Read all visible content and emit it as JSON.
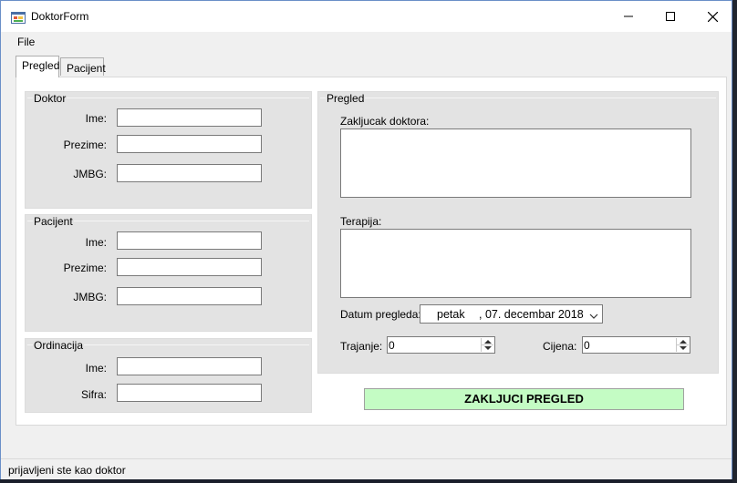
{
  "window": {
    "title": "DoktorForm"
  },
  "menu": {
    "file": "File"
  },
  "tabs": [
    {
      "label": "Pregled",
      "active": true
    },
    {
      "label": "Pacijent",
      "active": false
    }
  ],
  "doktor": {
    "title": "Doktor",
    "ime_label": "Ime:",
    "prezime_label": "Prezime:",
    "jmbg_label": "JMBG:",
    "ime_value": "",
    "prezime_value": "",
    "jmbg_value": ""
  },
  "pacijent": {
    "title": "Pacijent",
    "ime_label": "Ime:",
    "prezime_label": "Prezime:",
    "jmbg_label": "JMBG:",
    "ime_value": "",
    "prezime_value": "",
    "jmbg_value": ""
  },
  "ordinacija": {
    "title": "Ordinacija",
    "ime_label": "Ime:",
    "sifra_label": "Sifra:",
    "ime_value": "",
    "sifra_value": ""
  },
  "pregled": {
    "title": "Pregled",
    "zakljucak_label": "Zakljucak doktora:",
    "terapija_label": "Terapija:",
    "datum_label": "Datum pregleda:",
    "datum_day": "petak",
    "datum_rest": ", 07. decembar 2018",
    "trajanje_label": "Trajanje:",
    "trajanje_value": "0",
    "cijena_label": "Cijena:",
    "cijena_value": "0"
  },
  "actions": {
    "zakljuci": "ZAKLJUCI PREGLED"
  },
  "status": {
    "text": "prijavljeni ste kao doktor"
  },
  "colors": {
    "button_bg": "#c4fcc4",
    "group_bg": "#e3e3e3",
    "window_bg": "#f0f0f0"
  },
  "icons": {
    "app": "app-form-icon",
    "minimize": "minimize-icon",
    "maximize": "maximize-icon",
    "close": "close-icon",
    "dropdown": "chevron-down-icon"
  }
}
